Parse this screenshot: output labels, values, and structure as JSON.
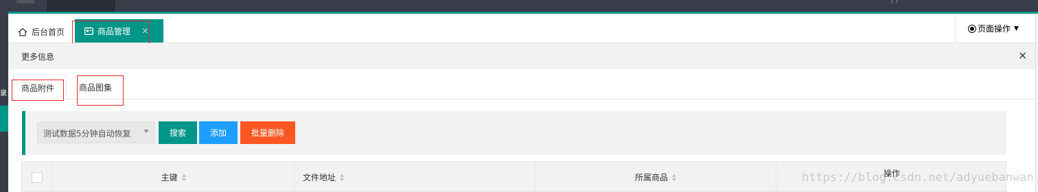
{
  "tabs": {
    "home_label": "后台首页",
    "active_label": "商品管理",
    "close_glyph": "×"
  },
  "page_ops": {
    "label": "页面操作"
  },
  "more_info": {
    "label": "更多信息",
    "close_glyph": "×"
  },
  "sub_tabs": [
    "商品附件",
    "商品图集"
  ],
  "toolbar": {
    "select_value": "测试数据5分钟自动恢复",
    "search_label": "搜索",
    "add_label": "添加",
    "batch_delete_label": "批量删除"
  },
  "table": {
    "columns": [
      "主键",
      "文件地址",
      "所属商品",
      "操作"
    ]
  },
  "sidebar": {
    "partial_glyph": "录"
  },
  "watermark": "https://blog.csdn.net/adyuebanwan",
  "colors": {
    "accent": "#009688",
    "blue": "#1e9fff",
    "orange": "#ff5722",
    "header_dark": "#393d49",
    "annotation_red": "#e8262a"
  },
  "icons": [
    "home-icon",
    "tab-page-icon",
    "radio-icon",
    "caret-down-icon",
    "close-icon",
    "sort-icon"
  ]
}
